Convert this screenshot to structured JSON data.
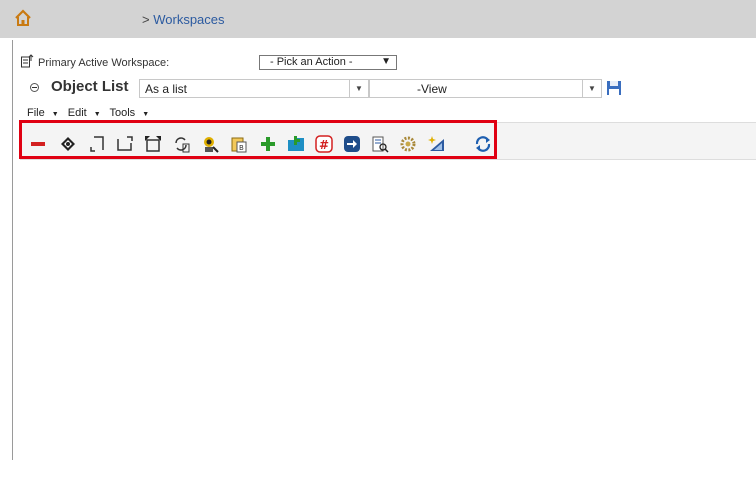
{
  "breadcrumb": {
    "prefix": "> ",
    "current": "Workspaces"
  },
  "workspace": {
    "label": "Primary Active Workspace:",
    "action_value": "- Pick an Action -"
  },
  "object_list": {
    "title": "Object List",
    "display_mode": "As a list",
    "view": "-View"
  },
  "menus": [
    {
      "label": "File"
    },
    {
      "label": "Edit"
    },
    {
      "label": "Tools"
    }
  ],
  "toolbar_icons": [
    "remove-icon",
    "navigate-icon",
    "bracket-left-icon",
    "bracket-right-icon",
    "expand-icon",
    "refresh-cycle-icon",
    "user-lookup-icon",
    "clipboard-icon",
    "add-icon",
    "folder-add-icon",
    "hash-icon",
    "go-arrow-icon",
    "list-search-icon",
    "gear-icon",
    "tool-wand-icon",
    "sync-icon"
  ],
  "colors": {
    "highlight": "#e00012",
    "topbar": "#d3d3d3",
    "link": "#2b5aa0",
    "add": "#2a9a2a",
    "remove": "#d32020"
  }
}
